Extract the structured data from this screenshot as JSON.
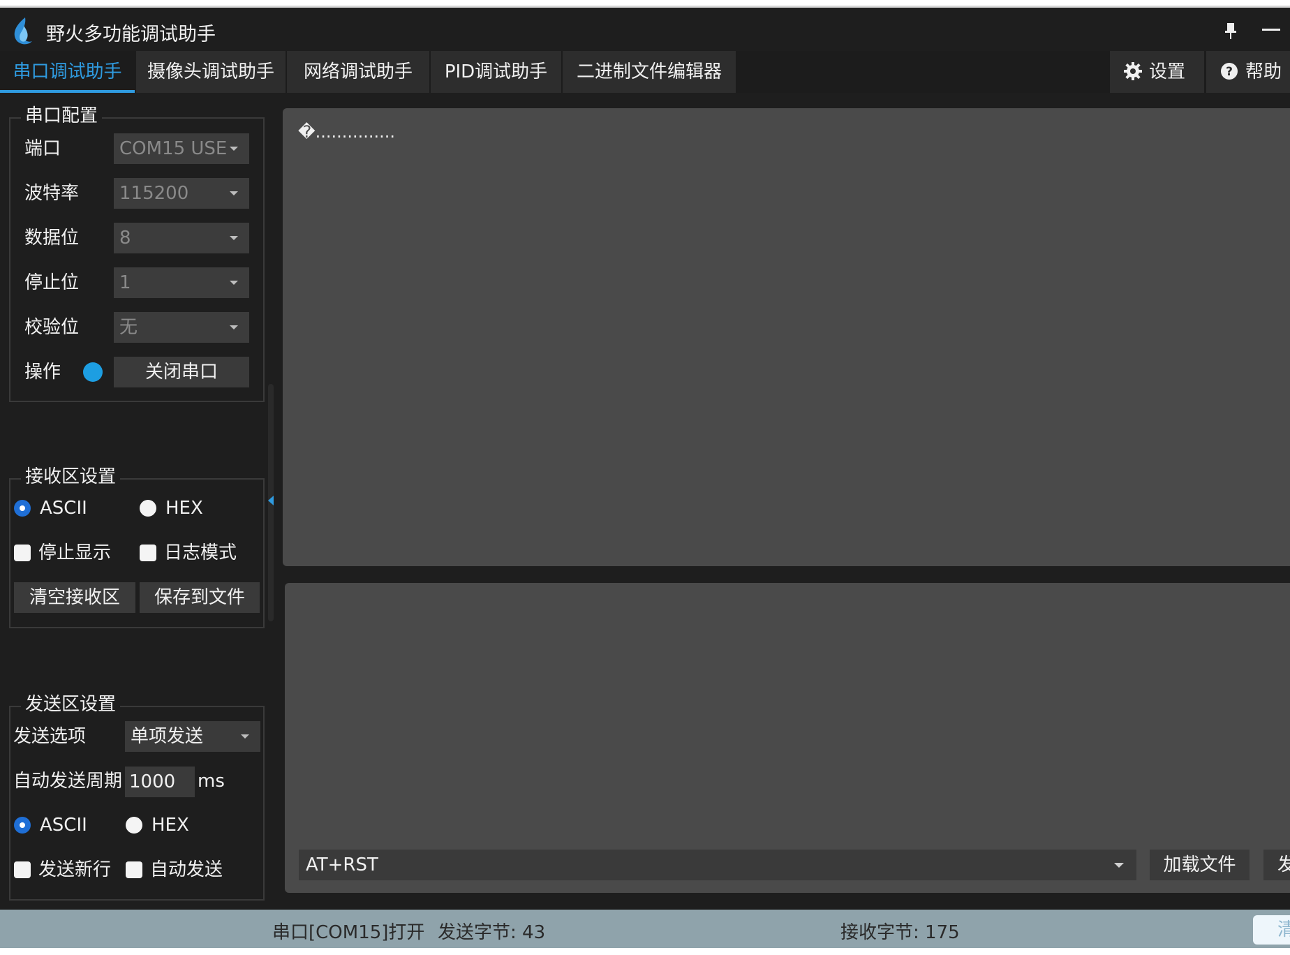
{
  "window": {
    "title": "野火多功能调试助手"
  },
  "tabs": [
    {
      "label": "串口调试助手",
      "active": true
    },
    {
      "label": "摄像头调试助手"
    },
    {
      "label": "网络调试助手"
    },
    {
      "label": "PID调试助手"
    },
    {
      "label": "二进制文件编辑器"
    }
  ],
  "toolbar": {
    "settings_label": "设置",
    "help_label": "帮助"
  },
  "serial_config": {
    "title": "串口配置",
    "port_label": "端口",
    "port_value": "COM15 USE",
    "baud_label": "波特率",
    "baud_value": "115200",
    "databits_label": "数据位",
    "databits_value": "8",
    "stopbits_label": "停止位",
    "stopbits_value": "1",
    "parity_label": "校验位",
    "parity_value": "无",
    "operation_label": "操作",
    "close_button": "关闭串口",
    "status_led_color": "#1d9ee2"
  },
  "receive_settings": {
    "title": "接收区设置",
    "ascii_label": "ASCII",
    "hex_label": "HEX",
    "mode_selected": "ASCII",
    "stop_display_label": "停止显示",
    "log_mode_label": "日志模式",
    "clear_button": "清空接收区",
    "save_button": "保存到文件"
  },
  "send_settings": {
    "title": "发送区设置",
    "option_label": "发送选项",
    "option_value": "单项发送",
    "period_label": "自动发送周期",
    "period_value": "1000",
    "period_unit": "ms",
    "ascii_label": "ASCII",
    "hex_label": "HEX",
    "mode_selected": "ASCII",
    "newline_label": "发送新行",
    "auto_send_label": "自动发送"
  },
  "receive_area": {
    "text": "�..............."
  },
  "send_area": {
    "command_value": "AT+RST",
    "load_file_button": "加载文件",
    "send_button": "发"
  },
  "status": {
    "port_status": "串口[COM15]打开",
    "sent_bytes": "发送字节: 43",
    "received_bytes": "接收字节: 175",
    "clear_button": "清"
  },
  "colors": {
    "accent": "#2f9be0",
    "panel_bg": "#1e1e1e",
    "area_bg": "#4a4a4a",
    "statusbar_bg": "#8fa3ab"
  }
}
